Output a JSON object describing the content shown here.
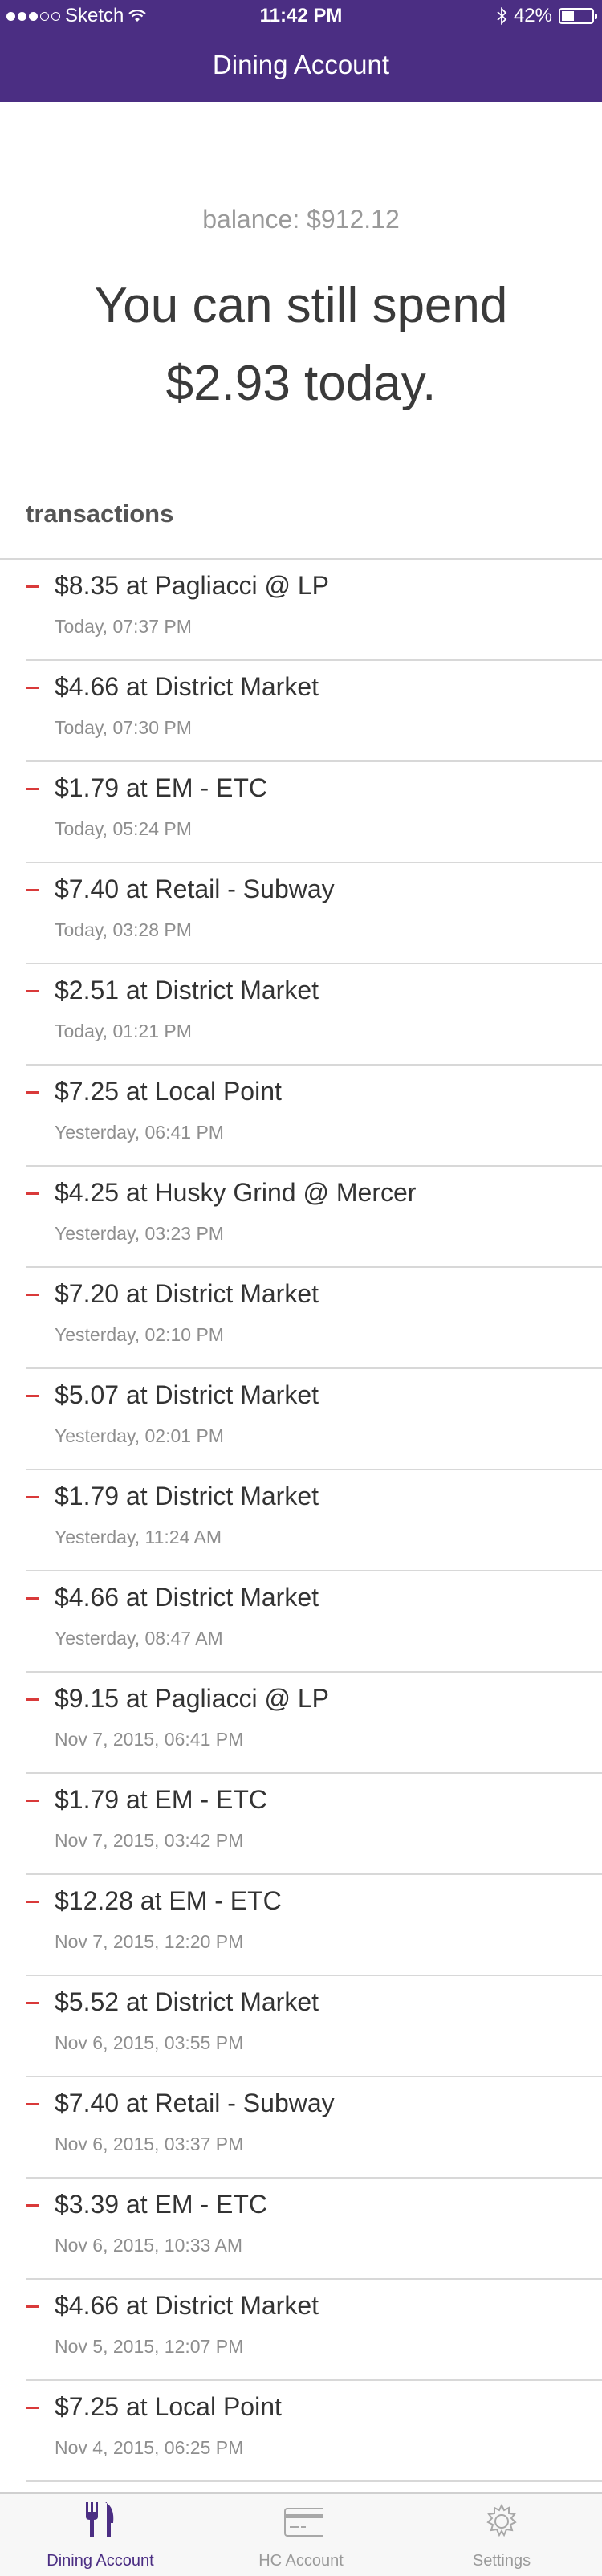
{
  "status_bar": {
    "carrier": "Sketch",
    "time": "11:42 PM",
    "battery": "42%",
    "battery_level": 0.42,
    "signal_dots_filled": 3,
    "signal_dots_total": 5
  },
  "nav": {
    "title": "Dining Account"
  },
  "summary": {
    "balance": "balance: $912.12",
    "spend_line1": "You can still spend",
    "spend_line2": "$2.93 today."
  },
  "transactions": {
    "header": "transactions",
    "items": [
      {
        "title": "$8.35 at Pagliacci @ LP",
        "time": "Today, 07:37 PM"
      },
      {
        "title": "$4.66 at District Market",
        "time": "Today, 07:30 PM"
      },
      {
        "title": "$1.79 at EM - ETC",
        "time": "Today, 05:24 PM"
      },
      {
        "title": "$7.40 at Retail - Subway",
        "time": "Today, 03:28 PM"
      },
      {
        "title": "$2.51 at District Market",
        "time": "Today, 01:21 PM"
      },
      {
        "title": "$7.25 at Local Point",
        "time": "Yesterday, 06:41 PM"
      },
      {
        "title": "$4.25 at Husky Grind @ Mercer",
        "time": "Yesterday, 03:23 PM"
      },
      {
        "title": "$7.20 at District Market",
        "time": "Yesterday, 02:10 PM"
      },
      {
        "title": "$5.07 at District Market",
        "time": "Yesterday, 02:01 PM"
      },
      {
        "title": "$1.79 at District Market",
        "time": "Yesterday, 11:24 AM"
      },
      {
        "title": "$4.66 at District Market",
        "time": "Yesterday, 08:47 AM"
      },
      {
        "title": "$9.15 at Pagliacci @ LP",
        "time": "Nov 7, 2015, 06:41 PM"
      },
      {
        "title": "$1.79 at EM - ETC",
        "time": "Nov 7, 2015, 03:42 PM"
      },
      {
        "title": "$12.28 at EM - ETC",
        "time": "Nov 7, 2015, 12:20 PM"
      },
      {
        "title": "$5.52 at District Market",
        "time": "Nov 6, 2015, 03:55 PM"
      },
      {
        "title": "$7.40 at Retail - Subway",
        "time": "Nov 6, 2015, 03:37 PM"
      },
      {
        "title": "$3.39 at EM - ETC",
        "time": "Nov 6, 2015, 10:33 AM"
      },
      {
        "title": "$4.66 at District Market",
        "time": "Nov 5, 2015, 12:07 PM"
      },
      {
        "title": "$7.25 at Local Point",
        "time": "Nov 4, 2015, 06:25 PM"
      }
    ]
  },
  "tab_bar": {
    "tabs": [
      {
        "label": "Dining Account",
        "icon": "fork-knife-icon",
        "active": true
      },
      {
        "label": "HC Account",
        "icon": "card-icon",
        "active": false
      },
      {
        "label": "Settings",
        "icon": "gear-icon",
        "active": false
      }
    ]
  },
  "colors": {
    "brand_purple": "#4b2e83",
    "debit_red": "#d93a3a",
    "inactive_gray": "#9a9a9a"
  }
}
